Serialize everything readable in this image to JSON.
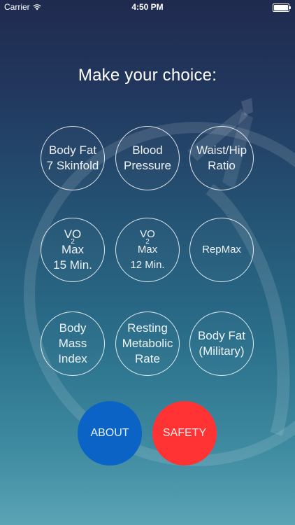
{
  "status_bar": {
    "carrier": "Carrier",
    "time": "4:50 PM"
  },
  "title": "Make your choice:",
  "choices": [
    {
      "line1": "Body Fat",
      "line2": "7 Skinfold"
    },
    {
      "line1": "Blood",
      "line2": "Pressure"
    },
    {
      "line1": "Waist/Hip",
      "line2": "Ratio"
    },
    {
      "prefix": "VO",
      "sup": "2",
      "suffix": " Max",
      "line2": "15 Min."
    },
    {
      "prefix": "VO",
      "sup": "2",
      "suffix": " Max",
      "line2": "12 Min."
    },
    {
      "line1": "RepMax"
    },
    {
      "line1": "Body",
      "line2": "Mass",
      "line3": "Index"
    },
    {
      "line1": "Resting",
      "line2": "Metabolic",
      "line3": "Rate"
    },
    {
      "line1": "Body Fat",
      "line2": "(Military)"
    }
  ],
  "buttons": {
    "about": "ABOUT",
    "safety": "SAFETY"
  },
  "colors": {
    "about": "#0a63c5",
    "safety": "#ff3333"
  }
}
